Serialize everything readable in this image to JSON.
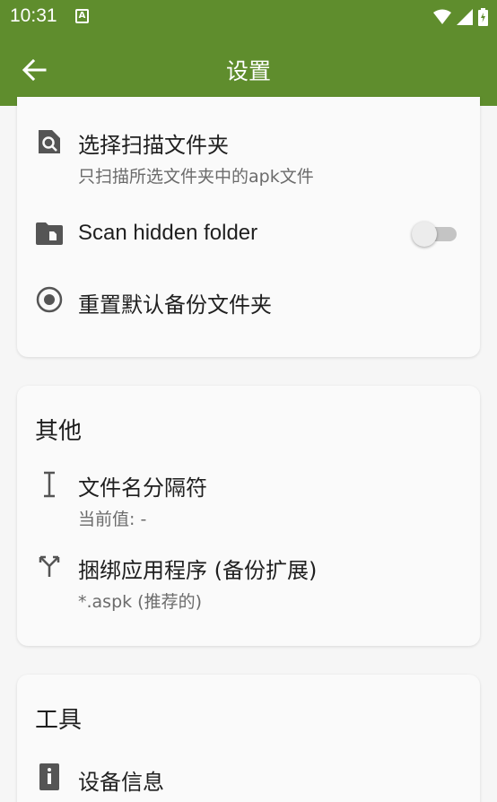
{
  "status_bar": {
    "time": "10:31",
    "notification_icon": "a-notification-icon",
    "wifi_icon": "wifi-icon",
    "signal_icon": "cell-signal-icon",
    "battery_icon": "battery-charging-icon"
  },
  "app_bar": {
    "title": "设置",
    "back_icon": "arrow-back-icon",
    "color": "#5f8d2d"
  },
  "scan_section": {
    "items": [
      {
        "title": "选择扫描文件夹",
        "subtitle": "只扫描所选文件夹中的apk文件",
        "icon": "folder-search-icon"
      },
      {
        "title": "Scan hidden folder",
        "icon": "hidden-folder-icon",
        "toggle_on": false
      },
      {
        "title": "重置默认备份文件夹",
        "icon": "radio-target-icon"
      }
    ]
  },
  "other_section": {
    "title": "其他",
    "items": [
      {
        "title": "文件名分隔符",
        "subtitle": "当前值: -",
        "icon": "text-cursor-icon"
      },
      {
        "title": "捆绑应用程序 (备份扩展)",
        "subtitle": "*.aspk (推荐的)",
        "icon": "merge-arrows-icon"
      }
    ]
  },
  "tools_section": {
    "title": "工具",
    "items": [
      {
        "title": "设备信息",
        "icon": "device-info-icon"
      }
    ]
  }
}
